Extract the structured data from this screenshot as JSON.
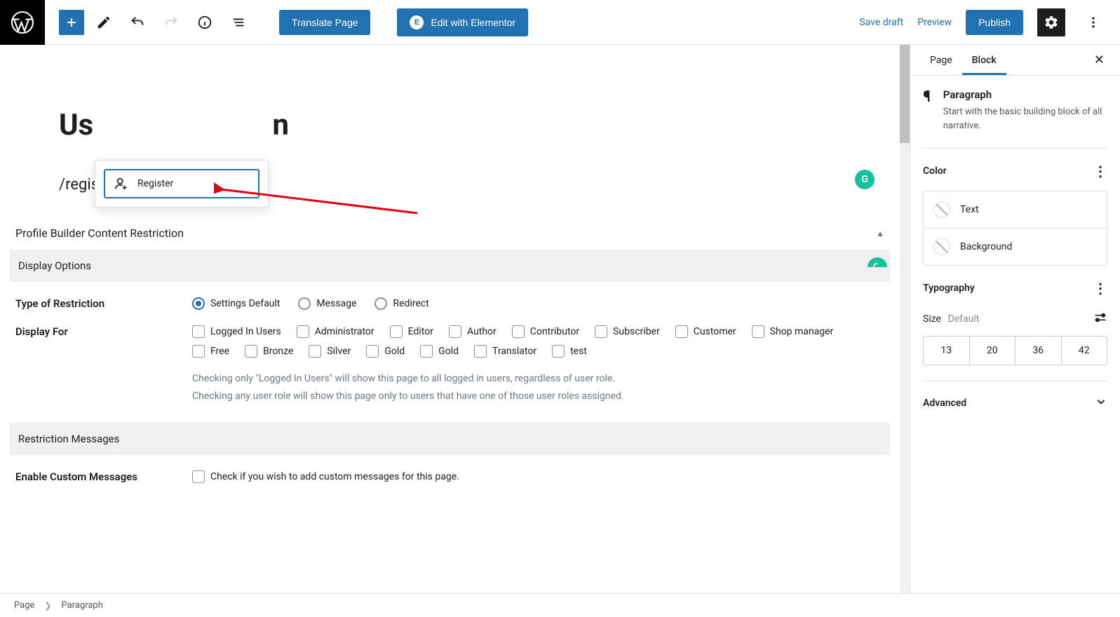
{
  "toolbar": {
    "translate_label": "Translate Page",
    "elementor_label": "Edit with Elementor",
    "save_draft": "Save draft",
    "preview": "Preview",
    "publish": "Publish"
  },
  "editor": {
    "page_title_visible": "Us",
    "page_title_hidden_end": "n",
    "slash_input": "/register",
    "suggestion": "Register"
  },
  "metabox": {
    "title": "Profile Builder Content Restriction",
    "sections": {
      "display_options": "Display Options",
      "restriction_messages": "Restriction Messages"
    },
    "labels": {
      "type_of_restriction": "Type of Restriction",
      "display_for": "Display For",
      "enable_custom_messages": "Enable Custom Messages"
    },
    "restriction_types": [
      "Settings Default",
      "Message",
      "Redirect"
    ],
    "restriction_selected": 0,
    "roles": [
      "Logged In Users",
      "Administrator",
      "Editor",
      "Author",
      "Contributor",
      "Subscriber",
      "Customer",
      "Shop manager",
      "Free",
      "Bronze",
      "Silver",
      "Gold",
      "Gold",
      "Translator",
      "test"
    ],
    "help1": "Checking only \"Logged In Users\" will show this page to all logged in users, regardless of user role.",
    "help2": "Checking any user role will show this page only to users that have one of those user roles assigned.",
    "custom_msg_help": "Check if you wish to add custom messages for this page."
  },
  "sidebar": {
    "tabs": {
      "page": "Page",
      "block": "Block"
    },
    "block": {
      "name": "Paragraph",
      "desc": "Start with the basic building block of all narrative."
    },
    "sections": {
      "color": "Color",
      "typography": "Typography",
      "advanced": "Advanced"
    },
    "color_items": [
      "Text",
      "Background"
    ],
    "size_label": "Size",
    "size_default": "Default",
    "sizes": [
      "13",
      "20",
      "36",
      "42"
    ]
  },
  "breadcrumb": [
    "Page",
    "Paragraph"
  ]
}
